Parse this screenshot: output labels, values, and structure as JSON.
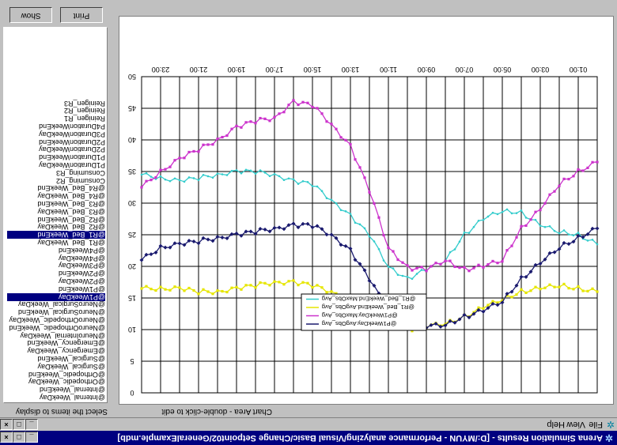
{
  "window": {
    "title": "Arena Simulation Results - [D:/MYUN - Performance analyzing/Visual Basic/Change Setpoint02/GeneralExample.mdb]"
  },
  "menu": {
    "items": [
      "File",
      "View",
      "Help"
    ]
  },
  "left_panel": {
    "hint": "Select the items to display",
    "buttons": {
      "show": "Show",
      "print": "Print"
    },
    "items": [
      "@Internal_WeekDay",
      "@Internal_WeekEnd",
      "@Orthopedic_WeekDay",
      "@Orthopedic_WeekEnd",
      "@Surgical_WeekDay",
      "@Surgical_WeekEnd",
      "@Emergency_WeekDay",
      "@Emergency_WeekEnd",
      "@NeuroInternal_WeekDay",
      "@NeuroOrthopedic_WeekEnd",
      "@NeuroOrthopedic_WeekDay",
      "@NeuroSurgical_WeekEnd",
      "@NeuroSurgical_WeekDay",
      "@P1WeekDay",
      "@P1WeekEnd",
      "@P2WeekDay",
      "@P2WeekEnd",
      "@P3WeekDay",
      "@P4WeekDay",
      "@P4WeekEnd",
      "@R1_Bed_WeekDay",
      "@R1_Bed_WeekEnd",
      "@R2_Bed_WeekDay",
      "@R2_Bed_WeekEnd",
      "@R3_Bed_WeekDay",
      "@R3_Bed_WeekEnd",
      "@R4_Bed_WeekDay",
      "@R4_Bed_WeekEnd",
      "Consuming_R2",
      "Consuming_R3",
      "P1DurationWeekDay",
      "P1DurationWeekEnd",
      "P2DurationWeekDay",
      "P2DurationWeekEnd",
      "P3DurationWeekDay",
      "P4DurationWeekEnd",
      "Reinigen_R1",
      "Reinigen_R2",
      "Reinigen_R3"
    ],
    "selected": [
      "@P1WeekDay",
      "@R1_Bed_WeekEnd"
    ]
  },
  "chart_panel": {
    "hint": "Chart Area - double-click to edit"
  },
  "chart_data": {
    "type": "line",
    "x_tick_labels": [
      "01:00",
      "03:00",
      "05:00",
      "07:00",
      "09:00",
      "11:00",
      "13:00",
      "15:00",
      "17:00",
      "19:00",
      "21:00",
      "23:00"
    ],
    "xlim": [
      0,
      24
    ],
    "y_ticks": [
      0,
      5,
      10,
      15,
      20,
      25,
      30,
      35,
      40,
      45,
      50
    ],
    "ylim": [
      0,
      50
    ],
    "grid": true,
    "legend_position": "bottom-left",
    "series": [
      {
        "name": "@R1_Bed_WeekEnd.MaxObs_Avg",
        "color": "#33cccc",
        "marker": "dot",
        "x": [
          0,
          1,
          2,
          3,
          4,
          5,
          6,
          7,
          8,
          9,
          10,
          11,
          12,
          13,
          14,
          15,
          16,
          17,
          18,
          19,
          20,
          21,
          22,
          23,
          24
        ],
        "y": [
          23.5,
          25,
          25.5,
          26.5,
          28.5,
          28.8,
          27.5,
          25,
          21,
          19.5,
          18,
          20,
          25,
          28,
          30.5,
          33,
          33.5,
          34.5,
          35,
          35,
          34.5,
          34,
          33.5,
          34,
          34.5
        ]
      },
      {
        "name": "@R1_Bed_WeekEnd.AvgObs_Avg",
        "color": "#e6e600",
        "marker": "square",
        "x": [
          0,
          1,
          2,
          3,
          4,
          5,
          6,
          7,
          8,
          9,
          10,
          11,
          12,
          13,
          14,
          15,
          16,
          17,
          18,
          19,
          20,
          21,
          22,
          23,
          24
        ],
        "y": [
          16,
          16.5,
          17,
          16.5,
          16,
          14.8,
          13.5,
          12,
          11,
          10.5,
          10,
          11,
          12.5,
          14.5,
          16,
          17,
          17.5,
          17.5,
          17,
          16.5,
          16,
          16,
          16.5,
          16.5,
          16.5
        ]
      },
      {
        "name": "@P1WeekDay.MaxObs_Avg",
        "color": "#cc33cc",
        "marker": "square",
        "x": [
          0,
          1,
          2,
          3,
          4,
          5,
          6,
          7,
          8,
          9,
          10,
          11,
          12,
          13,
          14,
          15,
          16,
          17,
          18,
          19,
          20,
          21,
          22,
          23,
          24
        ],
        "y": [
          36.5,
          35,
          33,
          29,
          26,
          21,
          20,
          19.5,
          21,
          19.5,
          19.8,
          23,
          32,
          39,
          42.5,
          45.5,
          46,
          43.5,
          43,
          42,
          40,
          38.5,
          37,
          35,
          32.5
        ]
      },
      {
        "name": "@P1WeekDay.AvgObs_Avg",
        "color": "#1a1a6e",
        "marker": "diamond",
        "x": [
          0,
          1,
          2,
          3,
          4,
          5,
          6,
          7,
          8,
          9,
          10,
          11,
          12,
          13,
          14,
          15,
          16,
          17,
          18,
          19,
          20,
          21,
          22,
          23,
          24
        ],
        "y": [
          26,
          24.5,
          23,
          20.5,
          18,
          14.5,
          13,
          12,
          10.8,
          10.5,
          11,
          13,
          18,
          22.5,
          25,
          26.5,
          26.5,
          26,
          25.5,
          25,
          24.5,
          24,
          23.5,
          23,
          21
        ]
      }
    ]
  }
}
